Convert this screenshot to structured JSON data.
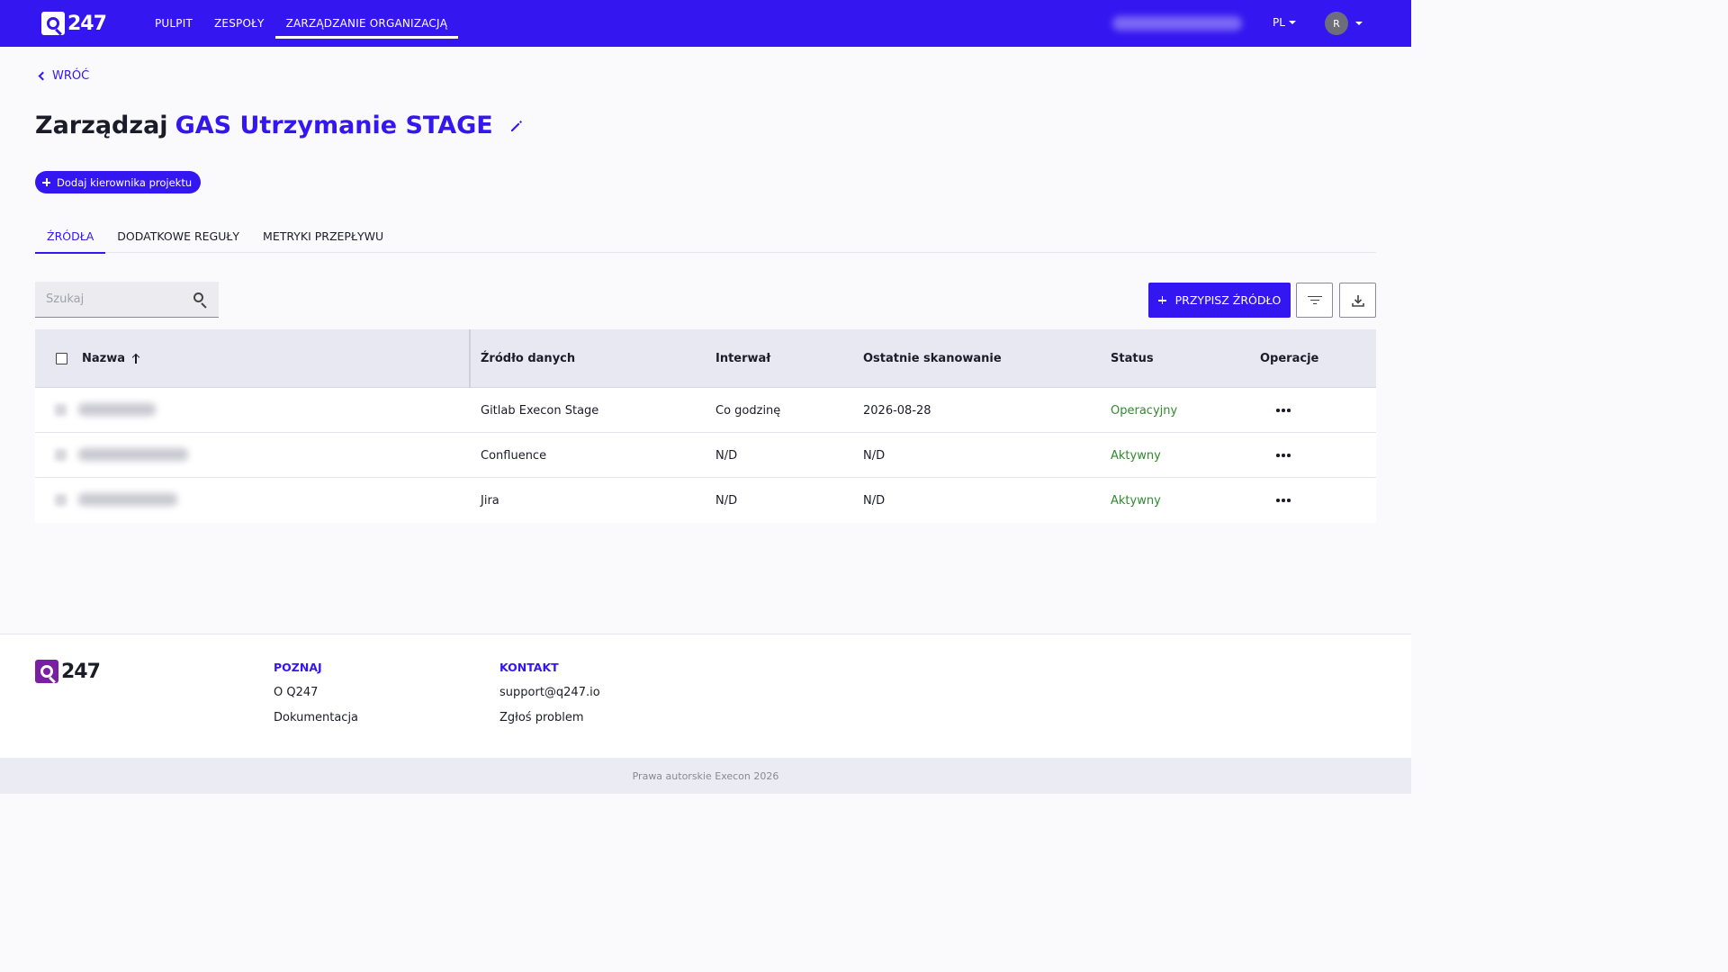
{
  "topbar": {
    "logo_text": "247",
    "nav": [
      {
        "label": "PULPIT"
      },
      {
        "label": "ZESPOŁY"
      },
      {
        "label": "ZARZĄDZANIE ORGANIZACJĄ",
        "active": true
      }
    ],
    "language": "PL",
    "avatar_initial": "R",
    "brand_color": "#3417f0"
  },
  "back_label": "WRÓĆ",
  "title": {
    "prefix": "Zarządzaj",
    "project": "GAS Utrzymanie STAGE"
  },
  "add_manager_label": "Dodaj kierownika projektu",
  "tabs": [
    {
      "label": "ŹRÓDŁA",
      "active": true
    },
    {
      "label": "DODATKOWE REGUŁY"
    },
    {
      "label": "METRYKI PRZEPŁYWU"
    }
  ],
  "search": {
    "placeholder": "Szukaj",
    "value": ""
  },
  "assign_source_label": "PRZYPISZ ŹRÓDŁO",
  "table": {
    "columns": [
      "Nazwa",
      "Źródło danych",
      "Interwał",
      "Ostatnie skanowanie",
      "Status",
      "Operacje"
    ],
    "rows": [
      {
        "source": "Gitlab Execon Stage",
        "interval": "Co godzinę",
        "last_scan": "2026-08-28",
        "status": "Operacyjny"
      },
      {
        "source": "Confluence",
        "interval": "N/D",
        "last_scan": "N/D",
        "status": "Aktywny"
      },
      {
        "source": "Jira",
        "interval": "N/D",
        "last_scan": "N/D",
        "status": "Aktywny"
      }
    ]
  },
  "footer": {
    "logo_text": "247",
    "col1": {
      "heading": "POZNAJ",
      "links": [
        "O Q247",
        "Dokumentacja"
      ]
    },
    "col2": {
      "heading": "KONTAKT",
      "links": [
        "support@q247.io",
        "Zgłoś problem"
      ]
    },
    "copyright": "Prawa autorskie Execon 2026"
  }
}
